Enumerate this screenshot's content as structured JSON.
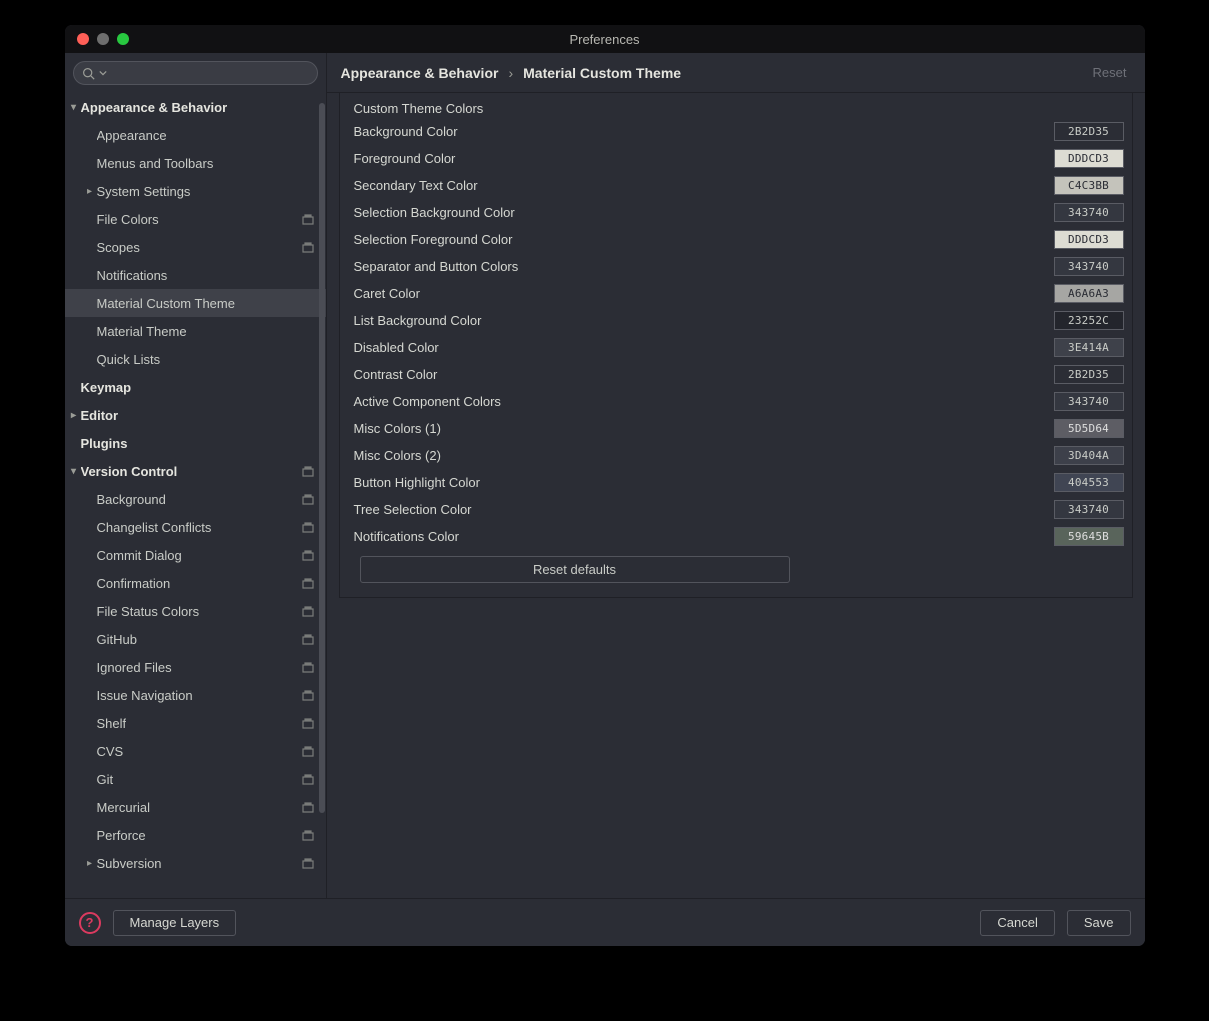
{
  "window": {
    "title": "Preferences"
  },
  "search": {
    "placeholder": ""
  },
  "breadcrumb": {
    "root": "Appearance & Behavior",
    "leaf": "Material Custom Theme",
    "reset": "Reset"
  },
  "sidebar": {
    "items": [
      {
        "label": "Appearance & Behavior",
        "depth": 0,
        "bold": true,
        "arrow": "down",
        "proj": false
      },
      {
        "label": "Appearance",
        "depth": 1,
        "bold": false,
        "arrow": "",
        "proj": false
      },
      {
        "label": "Menus and Toolbars",
        "depth": 1,
        "bold": false,
        "arrow": "",
        "proj": false
      },
      {
        "label": "System Settings",
        "depth": 1,
        "bold": false,
        "arrow": "right",
        "proj": false
      },
      {
        "label": "File Colors",
        "depth": 1,
        "bold": false,
        "arrow": "",
        "proj": true
      },
      {
        "label": "Scopes",
        "depth": 1,
        "bold": false,
        "arrow": "",
        "proj": true
      },
      {
        "label": "Notifications",
        "depth": 1,
        "bold": false,
        "arrow": "",
        "proj": false
      },
      {
        "label": "Material Custom Theme",
        "depth": 1,
        "bold": false,
        "arrow": "",
        "proj": false,
        "selected": true
      },
      {
        "label": "Material Theme",
        "depth": 1,
        "bold": false,
        "arrow": "",
        "proj": false
      },
      {
        "label": "Quick Lists",
        "depth": 1,
        "bold": false,
        "arrow": "",
        "proj": false
      },
      {
        "label": "Keymap",
        "depth": 0,
        "bold": true,
        "arrow": "",
        "proj": false
      },
      {
        "label": "Editor",
        "depth": 0,
        "bold": true,
        "arrow": "right",
        "proj": false
      },
      {
        "label": "Plugins",
        "depth": 0,
        "bold": true,
        "arrow": "",
        "proj": false
      },
      {
        "label": "Version Control",
        "depth": 0,
        "bold": true,
        "arrow": "down",
        "proj": true
      },
      {
        "label": "Background",
        "depth": 1,
        "bold": false,
        "arrow": "",
        "proj": true
      },
      {
        "label": "Changelist Conflicts",
        "depth": 1,
        "bold": false,
        "arrow": "",
        "proj": true
      },
      {
        "label": "Commit Dialog",
        "depth": 1,
        "bold": false,
        "arrow": "",
        "proj": true
      },
      {
        "label": "Confirmation",
        "depth": 1,
        "bold": false,
        "arrow": "",
        "proj": true
      },
      {
        "label": "File Status Colors",
        "depth": 1,
        "bold": false,
        "arrow": "",
        "proj": true
      },
      {
        "label": "GitHub",
        "depth": 1,
        "bold": false,
        "arrow": "",
        "proj": true
      },
      {
        "label": "Ignored Files",
        "depth": 1,
        "bold": false,
        "arrow": "",
        "proj": true
      },
      {
        "label": "Issue Navigation",
        "depth": 1,
        "bold": false,
        "arrow": "",
        "proj": true
      },
      {
        "label": "Shelf",
        "depth": 1,
        "bold": false,
        "arrow": "",
        "proj": true
      },
      {
        "label": "CVS",
        "depth": 1,
        "bold": false,
        "arrow": "",
        "proj": true
      },
      {
        "label": "Git",
        "depth": 1,
        "bold": false,
        "arrow": "",
        "proj": true
      },
      {
        "label": "Mercurial",
        "depth": 1,
        "bold": false,
        "arrow": "",
        "proj": true
      },
      {
        "label": "Perforce",
        "depth": 1,
        "bold": false,
        "arrow": "",
        "proj": true
      },
      {
        "label": "Subversion",
        "depth": 1,
        "bold": false,
        "arrow": "right",
        "proj": true
      }
    ]
  },
  "settings": {
    "section_header": "Custom Theme Colors",
    "rows": [
      {
        "label": "Background Color",
        "value": "2B2D35",
        "swatch": "#2B2D35",
        "text": "#c9ccc7"
      },
      {
        "label": "Foreground Color",
        "value": "DDDCD3",
        "swatch": "#DDDCD3",
        "text": "#2b2d35"
      },
      {
        "label": "Secondary Text Color",
        "value": "C4C3BB",
        "swatch": "#C4C3BB",
        "text": "#2b2d35"
      },
      {
        "label": "Selection Background Color",
        "value": "343740",
        "swatch": "#343740",
        "text": "#c9ccc7"
      },
      {
        "label": "Selection Foreground Color",
        "value": "DDDCD3",
        "swatch": "#DDDCD3",
        "text": "#2b2d35"
      },
      {
        "label": "Separator and Button Colors",
        "value": "343740",
        "swatch": "#343740",
        "text": "#c9ccc7"
      },
      {
        "label": "Caret Color",
        "value": "A6A6A3",
        "swatch": "#A6A6A3",
        "text": "#2b2d35"
      },
      {
        "label": "List Background Color",
        "value": "23252C",
        "swatch": "#23252C",
        "text": "#c9ccc7"
      },
      {
        "label": "Disabled Color",
        "value": "3E414A",
        "swatch": "#3E414A",
        "text": "#c9ccc7"
      },
      {
        "label": "Contrast Color",
        "value": "2B2D35",
        "swatch": "#2B2D35",
        "text": "#c9ccc7"
      },
      {
        "label": "Active Component Colors",
        "value": "343740",
        "swatch": "#343740",
        "text": "#c9ccc7"
      },
      {
        "label": "Misc Colors (1)",
        "value": "5D5D64",
        "swatch": "#5D5D64",
        "text": "#dedede"
      },
      {
        "label": "Misc Colors (2)",
        "value": "3D404A",
        "swatch": "#3D404A",
        "text": "#c9ccc7"
      },
      {
        "label": "Button Highlight Color",
        "value": "404553",
        "swatch": "#404553",
        "text": "#c9ccc7"
      },
      {
        "label": "Tree Selection Color",
        "value": "343740",
        "swatch": "#343740",
        "text": "#c9ccc7"
      },
      {
        "label": "Notifications Color",
        "value": "59645B",
        "swatch": "#59645B",
        "text": "#dedede"
      }
    ],
    "reset_defaults": "Reset defaults"
  },
  "footer": {
    "manage_layers": "Manage Layers",
    "cancel": "Cancel",
    "save": "Save"
  }
}
